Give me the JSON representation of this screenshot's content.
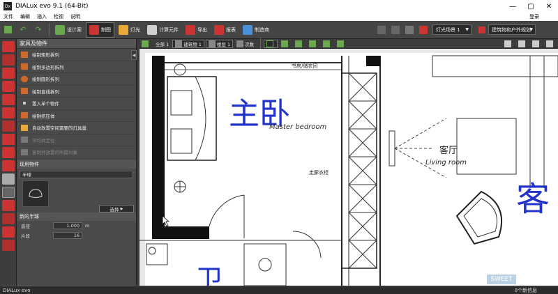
{
  "app": {
    "title": "DIALux evo 9.1  (64-Bit)",
    "logo_text": "Dx"
  },
  "menu": {
    "items": [
      "文件",
      "编辑",
      "插入",
      "检视",
      "说明"
    ],
    "login": "登录"
  },
  "toolbar": {
    "modes": [
      {
        "label": "设计案",
        "icon": "project-icon",
        "color": "#6aa84f"
      },
      {
        "label": "制图",
        "icon": "construction-icon",
        "color": "#cc3333"
      },
      {
        "label": "灯光",
        "icon": "light-icon",
        "color": "#e8a93a"
      },
      {
        "label": "计算元件",
        "icon": "calc-objects-icon",
        "color": "#d0d0d0"
      },
      {
        "label": "导出",
        "icon": "export-icon",
        "color": "#cc3333"
      },
      {
        "label": "报表",
        "icon": "report-icon",
        "color": "#cc3333"
      },
      {
        "label": "制造商",
        "icon": "manufacturer-icon",
        "color": "#4a90d9"
      }
    ],
    "active_mode": "制图",
    "light_scene": "灯光场景 1",
    "planning": "建筑物和户外规划"
  },
  "panel": {
    "title": "家具及物件",
    "items": [
      {
        "label": "绘制矩形拆列",
        "disabled": false
      },
      {
        "label": "绘制多边形拆列",
        "disabled": false
      },
      {
        "label": "绘制圆形拆列",
        "disabled": false
      },
      {
        "label": "绘制直线拆列",
        "disabled": false
      },
      {
        "label": "置入单个物件",
        "disabled": false
      },
      {
        "label": "绘制挤压体",
        "disabled": false
      },
      {
        "label": "自动放置空间需要的灯具量",
        "disabled": false
      },
      {
        "label": "平均并定位",
        "disabled": true
      },
      {
        "label": "复制并放置的所需对象",
        "disabled": true
      }
    ],
    "used_section": "现用物件",
    "used_object": "半球",
    "select_button": "选择",
    "new_section": "新的半球",
    "diameter_label": "直径",
    "diameter_value": "1.000",
    "diameter_unit": "m",
    "segments_label": "片段",
    "segments_value": "16"
  },
  "viewbar": {
    "all": "全部 1",
    "building": "建筑物 1",
    "model": "楼层 1",
    "level": "次数"
  },
  "drawing": {
    "label_master": "主卧",
    "label_master_en": "Master bedroom",
    "label_living_cn": "客厅",
    "label_living_en": "Living room",
    "label_small_cn": "书房/储衣间",
    "label_wardrobe": "走廊衣柜",
    "label_guest_big": "客",
    "label_bath_big": "卫"
  },
  "status": {
    "left": "DIALux evo",
    "right": "0个新信息"
  },
  "watermark": "SWEET"
}
